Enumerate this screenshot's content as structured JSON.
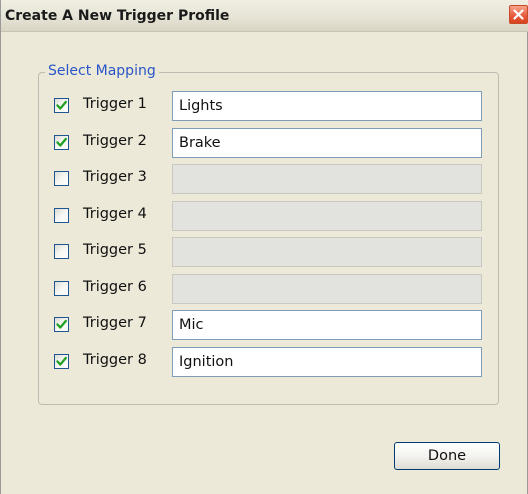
{
  "window": {
    "title": "Create A New Trigger Profile"
  },
  "group": {
    "label": "Select Mapping"
  },
  "triggers": [
    {
      "label": "Trigger 1",
      "checked": true,
      "value": "Lights",
      "enabled": true
    },
    {
      "label": "Trigger 2",
      "checked": true,
      "value": "Brake",
      "enabled": true
    },
    {
      "label": "Trigger 3",
      "checked": false,
      "value": "",
      "enabled": false
    },
    {
      "label": "Trigger 4",
      "checked": false,
      "value": "",
      "enabled": false
    },
    {
      "label": "Trigger 5",
      "checked": false,
      "value": "",
      "enabled": false
    },
    {
      "label": "Trigger 6",
      "checked": false,
      "value": "",
      "enabled": false
    },
    {
      "label": "Trigger 7",
      "checked": true,
      "value": "Mic",
      "enabled": true
    },
    {
      "label": "Trigger 8",
      "checked": true,
      "value": "Ignition",
      "enabled": true
    }
  ],
  "buttons": {
    "done_label": "Done"
  },
  "icons": {
    "close": "close-icon",
    "check": "checkmark-icon"
  },
  "colors": {
    "group_label": "#2a55c8",
    "close_button": "#e5583a",
    "checkmark": "#21a121"
  }
}
